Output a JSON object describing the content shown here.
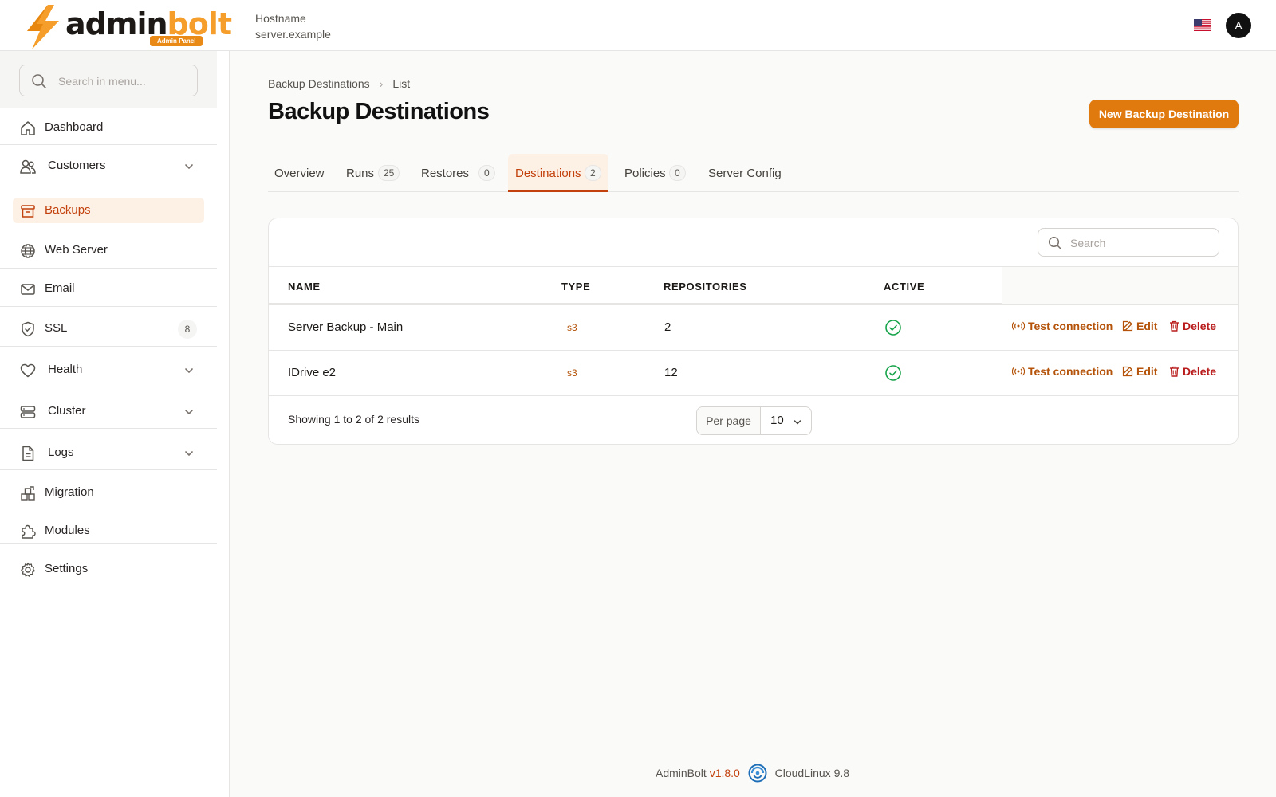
{
  "brand": {
    "name_part1": "admin",
    "name_part2": "bolt",
    "badge": "Admin Panel"
  },
  "header": {
    "host_label": "Hostname",
    "host_value": "server.example",
    "avatar_initial": "A"
  },
  "sidebar": {
    "search_placeholder": "Search in menu...",
    "items": [
      {
        "label": "Dashboard",
        "icon": "home-icon"
      },
      {
        "label": "Customers",
        "icon": "users-icon",
        "expandable": true
      },
      {
        "label": "Backups",
        "icon": "archive-icon",
        "active": true
      },
      {
        "label": "Web Server",
        "icon": "globe-icon"
      },
      {
        "label": "Email",
        "icon": "envelope-icon"
      },
      {
        "label": "SSL",
        "icon": "shield-icon",
        "count": "8"
      },
      {
        "label": "Health",
        "icon": "heart-icon",
        "expandable": true
      },
      {
        "label": "Cluster",
        "icon": "server-icon",
        "expandable": true
      },
      {
        "label": "Logs",
        "icon": "document-icon",
        "expandable": true
      },
      {
        "label": "Migration",
        "icon": "migration-icon"
      },
      {
        "label": "Modules",
        "icon": "puzzle-icon"
      },
      {
        "label": "Settings",
        "icon": "gear-icon"
      }
    ]
  },
  "breadcrumb": {
    "parent": "Backup Destinations",
    "current": "List"
  },
  "page": {
    "title": "Backup Destinations",
    "new_button": "New Backup Destination"
  },
  "tabs": [
    {
      "label": "Overview"
    },
    {
      "label": "Runs",
      "count": "25"
    },
    {
      "label": "Restores",
      "count": "0"
    },
    {
      "label": "Destinations",
      "count": "2",
      "active": true
    },
    {
      "label": "Policies",
      "count": "0"
    },
    {
      "label": "Server Config"
    }
  ],
  "table": {
    "search_placeholder": "Search",
    "columns": [
      "NAME",
      "TYPE",
      "REPOSITORIES",
      "ACTIVE"
    ],
    "rows": [
      {
        "name": "Server Backup - Main",
        "type": "s3",
        "repositories": "2",
        "active": true
      },
      {
        "name": "IDrive e2",
        "type": "s3",
        "repositories": "12",
        "active": true
      }
    ],
    "actions": {
      "test": "Test connection",
      "edit": "Edit",
      "delete": "Delete"
    },
    "summary": "Showing 1 to 2 of 2 results",
    "per_page_label": "Per page",
    "per_page_value": "10"
  },
  "footer": {
    "product": "AdminBolt",
    "version": "v1.8.0",
    "os": "CloudLinux 9.8"
  },
  "colors": {
    "accent": "#e07a0f",
    "active_text": "#c2410c",
    "active_bg": "#fdf0e5",
    "success": "#16a34a",
    "danger": "#b91c1c"
  }
}
